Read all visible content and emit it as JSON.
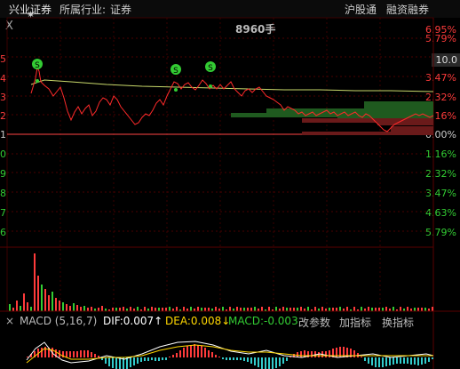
{
  "header": {
    "stock_name": "兴业证券",
    "industry_label": "所属行业:",
    "industry_value": "证券",
    "hk_connect": "沪股通",
    "margin": "融资融券"
  },
  "volume_top": "8960手",
  "close_glyph": "X",
  "right_axis": [
    {
      "label": "6.95%",
      "color": "#ff3b3b"
    },
    {
      "label": "5.79%",
      "color": "#ff3b3b"
    },
    {
      "label": "3.47%",
      "color": "#ff3b3b"
    },
    {
      "label": "2.32%",
      "color": "#ff3b3b"
    },
    {
      "label": "1.16%",
      "color": "#ff3b3b"
    },
    {
      "label": "0.00%",
      "color": "#cccccc"
    },
    {
      "label": "1.16%",
      "color": "#33cc33"
    },
    {
      "label": "2.32%",
      "color": "#33cc33"
    },
    {
      "label": "3.47%",
      "color": "#33cc33"
    },
    {
      "label": "4.63%",
      "color": "#33cc33"
    },
    {
      "label": "5.79%",
      "color": "#33cc33"
    }
  ],
  "price_tag": "10.0",
  "left_axis": [
    "5",
    "4",
    "3",
    "2",
    "1",
    "0",
    "9",
    "8",
    "7",
    "6",
    "5",
    "4"
  ],
  "macd": {
    "name": "MACD (5,16,7)",
    "dif": "DIF:0.007↑",
    "dea": "DEA:0.008↓",
    "macd": "MACD:-0.003",
    "change_param": "改参数",
    "add_indicator": "加指标",
    "switch_indicator": "换指标"
  },
  "signal_marker": "S",
  "colors": {
    "up": "#ff3b3b",
    "down": "#33cc33",
    "avg": "#c8d86a",
    "white": "#ffffff",
    "yellow": "#ffd700"
  }
}
